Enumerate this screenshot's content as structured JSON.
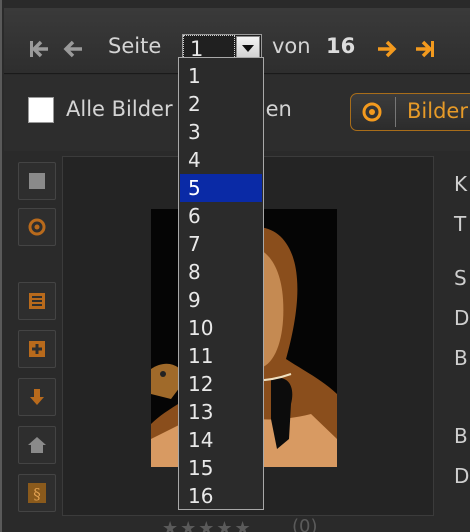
{
  "pager": {
    "page_label": "Seite",
    "current_page": "1",
    "of_label": "von",
    "total_pages": "16",
    "icons": [
      "first-page-icon",
      "previous-page-icon",
      "next-page-icon",
      "last-page-icon"
    ],
    "accent_color": "#f39a1e"
  },
  "page_dropdown": {
    "options": [
      "1",
      "2",
      "3",
      "4",
      "5",
      "6",
      "7",
      "8",
      "9",
      "10",
      "11",
      "12",
      "13",
      "14",
      "15",
      "16"
    ],
    "highlighted": "5",
    "highlight_color": "#0a2aa6"
  },
  "selection": {
    "select_all_label": "Alle Bilder auswählen",
    "images_button_label": "Bilder"
  },
  "toolbar": {
    "icons": [
      "select-square-icon",
      "target-icon",
      "details-icon",
      "add-icon",
      "download-icon",
      "home-icon",
      "paragraph-icon"
    ]
  },
  "metadata": {
    "labels": [
      "K",
      "T",
      "S",
      "D",
      "B",
      "B",
      "D"
    ]
  },
  "rating": {
    "stars": "★★★★★",
    "count": "(0)"
  }
}
